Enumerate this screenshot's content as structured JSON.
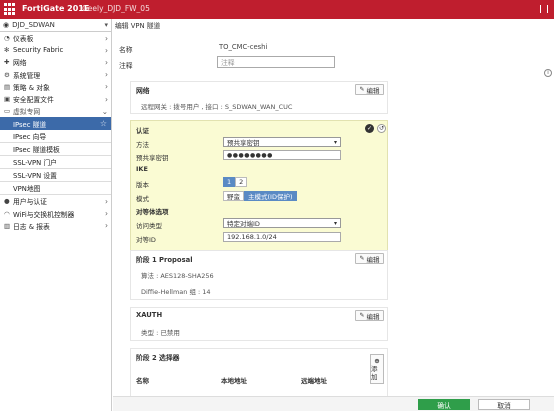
{
  "topbar": {
    "brand": "FortiGate 201E",
    "host": "Geely_DJD_FW_05"
  },
  "sidebar": {
    "vdom": "DJD_SDWAN",
    "items": [
      {
        "icon": "dashboard-icon",
        "label": "仪表板"
      },
      {
        "icon": "security-fabric-icon",
        "label": "Security Fabric"
      },
      {
        "icon": "network-icon",
        "label": "网络"
      },
      {
        "icon": "system-icon",
        "label": "系统管理"
      },
      {
        "icon": "policy-icon",
        "label": "策略 & 对象"
      },
      {
        "icon": "security-profile-icon",
        "label": "安全配置文件"
      },
      {
        "icon": "vpn-icon",
        "label": "虚拟专网"
      }
    ],
    "vpn_sub": [
      "IPsec 隧道",
      "IPsec 向导",
      "IPsec 隧道模板",
      "SSL-VPN 门户",
      "SSL-VPN 设置",
      "VPN地图"
    ],
    "bottom_items": [
      {
        "icon": "user-icon",
        "label": "用户与认证"
      },
      {
        "icon": "wifi-icon",
        "label": "WiFi与交换机控制器"
      },
      {
        "icon": "log-icon",
        "label": "日志 & 报表"
      }
    ]
  },
  "main": {
    "title": "编辑 VPN 隧道",
    "name_label": "名称",
    "name_value": "TO_CMC-ceshi",
    "comment_label": "注释",
    "comment_placeholder": "注释",
    "network": {
      "title": "网络",
      "edit": "编辑",
      "text": "远程网关 : 拨号用户 , 接口 : S_SDWAN_WAN_CUC"
    },
    "auth": {
      "title": "认证",
      "method_label": "方法",
      "method_value": "预共享密钥",
      "psk_label": "预共享密钥",
      "psk_value": "●●●●●●●●",
      "ike_title": "IKE",
      "version_label": "版本",
      "versions": [
        "1",
        "2"
      ],
      "mode_label": "模式",
      "modes": [
        "野蛮",
        "主模式(ID保护)"
      ],
      "peer_title": "对等体选项",
      "access_label": "访问类型",
      "access_value": "特定对端ID",
      "peer_id_label": "对等ID",
      "peer_id_value": "192.168.1.0/24"
    },
    "phase1": {
      "title": "阶段 1 Proposal",
      "edit": "编辑",
      "algo": "算法 : AES128-SHA256",
      "dh": "Diffie-Hellman 组 : 14"
    },
    "xauth": {
      "title": "XAUTH",
      "edit": "编辑",
      "type": "类型 : 已禁用"
    },
    "phase2": {
      "title": "阶段 2 选择器",
      "add": "添加",
      "col_name": "名称",
      "col_local": "本地地址",
      "col_remote": "远端地址"
    }
  },
  "footer": {
    "ok": "确认",
    "cancel": "取消"
  },
  "colors": {
    "brand_red": "#bf1e2e",
    "nav_active": "#3c6aa9",
    "auth_bg": "#fafbd3",
    "ok_green": "#2f9e4a"
  }
}
